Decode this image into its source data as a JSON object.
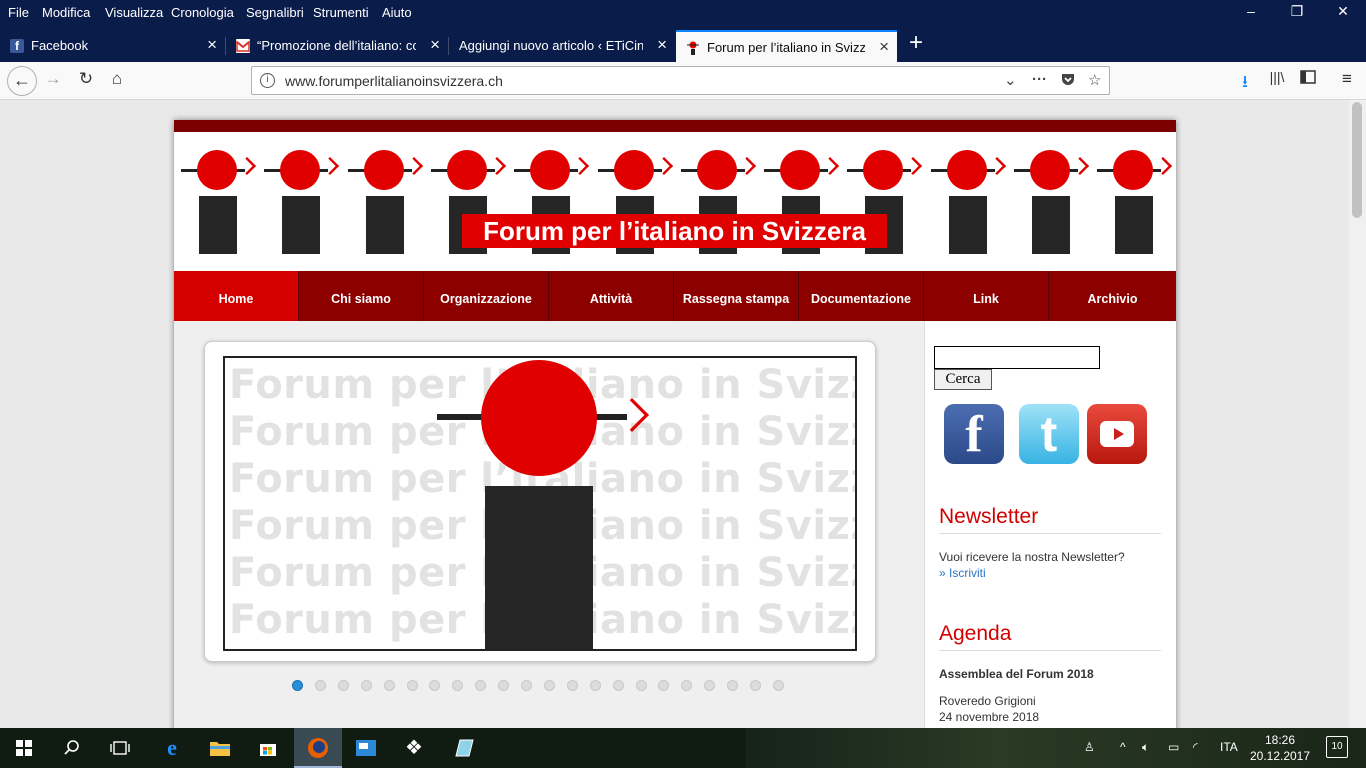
{
  "menubar": {
    "items": [
      "File",
      "Modifica",
      "Visualizza",
      "Cronologia",
      "Segnalibri",
      "Strumenti",
      "Aiuto"
    ],
    "window_controls": [
      "–",
      "❐",
      "✕"
    ]
  },
  "tabs": [
    {
      "title": "Facebook",
      "icon": "facebook-icon"
    },
    {
      "title": "“Promozione dell’italiano: com",
      "icon": "gmail-icon"
    },
    {
      "title": "Aggiungi nuovo articolo ‹ ETiCinfor",
      "icon": "wordpress-icon"
    },
    {
      "title": "Forum per l’italiano in Svizzera",
      "icon": "forum-icon",
      "active": true
    }
  ],
  "newtab_label": "+",
  "url": "www.forumperlitalianoinsvizzera.ch",
  "site": {
    "banner_title": "Forum per l’italiano in Svizzera",
    "nav": [
      "Home",
      "Chi siamo",
      "Organizzazione",
      "Attività",
      "Rassegna stampa",
      "Documentazione",
      "Link",
      "Archivio"
    ],
    "active_nav": "Home",
    "slide_watermark": "Forum per l’italiano in Svizzera",
    "slider_dot_count": 22,
    "active_dot": 0
  },
  "sidebar": {
    "search_button": "Cerca",
    "social": [
      "facebook-icon",
      "twitter-icon",
      "youtube-icon"
    ],
    "newsletter_title": "Newsletter",
    "newsletter_text": "Vuoi ricevere la nostra Newsletter?",
    "newsletter_link": "» Iscriviti",
    "agenda_title": "Agenda",
    "agenda_event": "Assemblea del Forum 2018",
    "agenda_place": "Roveredo Grigioni",
    "agenda_date": "24 novembre 2018"
  },
  "taskbar": {
    "language": "ITA",
    "time": "18:26",
    "date": "20.12.2017",
    "notifications": "10"
  },
  "colors": {
    "brand_red": "#e00000",
    "nav_dark_red": "#8c0000",
    "nav_active_red": "#d40000",
    "firefox_titlebar": "#0a1c4a"
  }
}
